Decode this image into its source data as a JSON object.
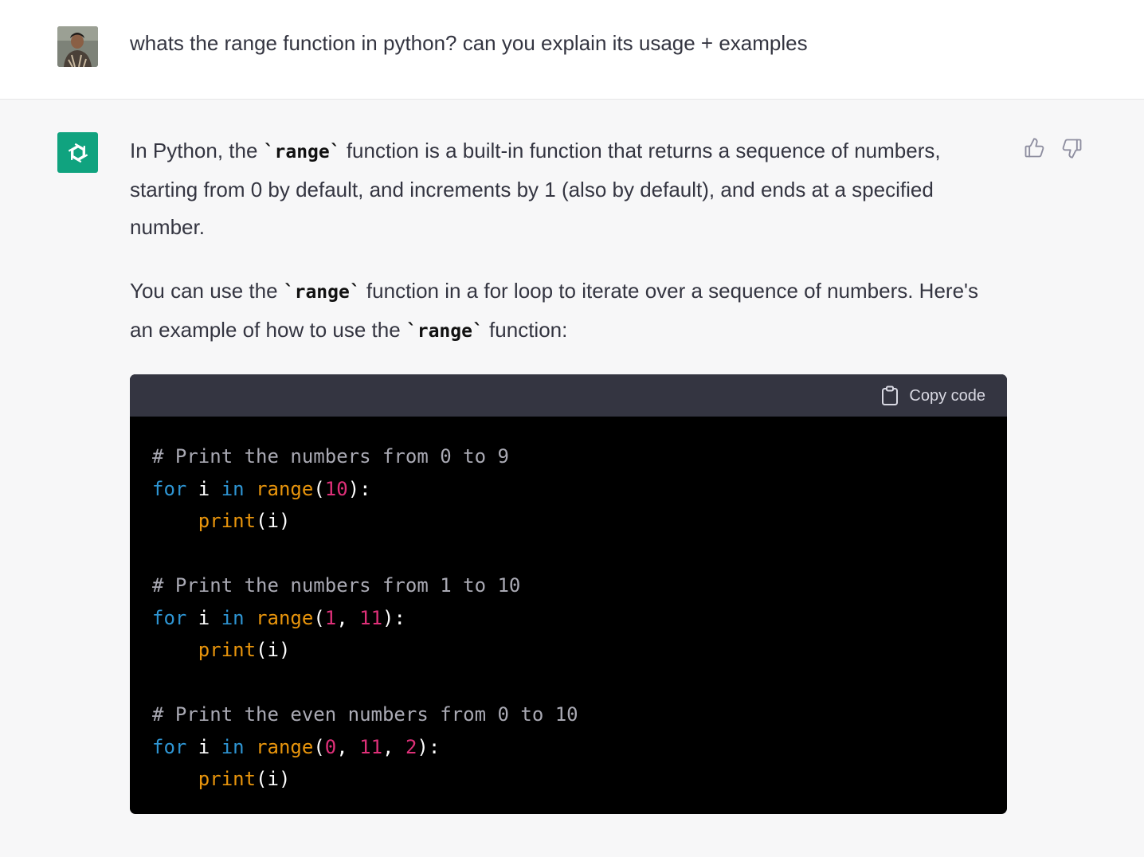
{
  "user_message": {
    "text": "whats the range function in python? can you explain its usage + examples"
  },
  "assistant_message": {
    "paragraphs": [
      {
        "parts": [
          {
            "type": "text",
            "text": "In Python, the "
          },
          {
            "type": "code",
            "text": "`range`"
          },
          {
            "type": "text",
            "text": " function is a built-in function that returns a sequence of numbers, starting from 0 by default, and increments by 1 (also by default), and ends at a specified number."
          }
        ]
      },
      {
        "parts": [
          {
            "type": "text",
            "text": "You can use the "
          },
          {
            "type": "code",
            "text": "`range`"
          },
          {
            "type": "text",
            "text": " function in a for loop to iterate over a sequence of numbers. Here's an example of how to use the "
          },
          {
            "type": "code",
            "text": "`range`"
          },
          {
            "type": "text",
            "text": " function:"
          }
        ]
      }
    ],
    "code_block": {
      "copy_label": "Copy code",
      "lines": [
        [
          {
            "t": "cm",
            "v": "# Print the numbers from 0 to 9"
          }
        ],
        [
          {
            "t": "kw",
            "v": "for"
          },
          {
            "t": "id",
            "v": " i "
          },
          {
            "t": "kw",
            "v": "in"
          },
          {
            "t": "id",
            "v": " "
          },
          {
            "t": "bi",
            "v": "range"
          },
          {
            "t": "id",
            "v": "("
          },
          {
            "t": "nm",
            "v": "10"
          },
          {
            "t": "id",
            "v": "):"
          }
        ],
        [
          {
            "t": "id",
            "v": "    "
          },
          {
            "t": "bi",
            "v": "print"
          },
          {
            "t": "id",
            "v": "(i)"
          }
        ],
        [],
        [
          {
            "t": "cm",
            "v": "# Print the numbers from 1 to 10"
          }
        ],
        [
          {
            "t": "kw",
            "v": "for"
          },
          {
            "t": "id",
            "v": " i "
          },
          {
            "t": "kw",
            "v": "in"
          },
          {
            "t": "id",
            "v": " "
          },
          {
            "t": "bi",
            "v": "range"
          },
          {
            "t": "id",
            "v": "("
          },
          {
            "t": "nm",
            "v": "1"
          },
          {
            "t": "id",
            "v": ", "
          },
          {
            "t": "nm",
            "v": "11"
          },
          {
            "t": "id",
            "v": "):"
          }
        ],
        [
          {
            "t": "id",
            "v": "    "
          },
          {
            "t": "bi",
            "v": "print"
          },
          {
            "t": "id",
            "v": "(i)"
          }
        ],
        [],
        [
          {
            "t": "cm",
            "v": "# Print the even numbers from 0 to 10"
          }
        ],
        [
          {
            "t": "kw",
            "v": "for"
          },
          {
            "t": "id",
            "v": " i "
          },
          {
            "t": "kw",
            "v": "in"
          },
          {
            "t": "id",
            "v": " "
          },
          {
            "t": "bi",
            "v": "range"
          },
          {
            "t": "id",
            "v": "("
          },
          {
            "t": "nm",
            "v": "0"
          },
          {
            "t": "id",
            "v": ", "
          },
          {
            "t": "nm",
            "v": "11"
          },
          {
            "t": "id",
            "v": ", "
          },
          {
            "t": "nm",
            "v": "2"
          },
          {
            "t": "id",
            "v": "):"
          }
        ],
        [
          {
            "t": "id",
            "v": "    "
          },
          {
            "t": "bi",
            "v": "print"
          },
          {
            "t": "id",
            "v": "(i)"
          }
        ]
      ]
    }
  },
  "icons": {
    "user_avatar": "user-avatar-photo",
    "bot_avatar": "openai-logo-icon",
    "thumbs_up": "thumbs-up-icon",
    "thumbs_down": "thumbs-down-icon",
    "copy": "clipboard-icon"
  },
  "colors": {
    "bot_avatar_bg": "#10a37f",
    "assistant_bg": "#f7f7f8",
    "code_header_bg": "#343541",
    "code_bg": "#000000",
    "keyword": "#2e95d3",
    "builtin": "#e9950c",
    "number": "#df3079",
    "comment": "#a9a9b3"
  }
}
